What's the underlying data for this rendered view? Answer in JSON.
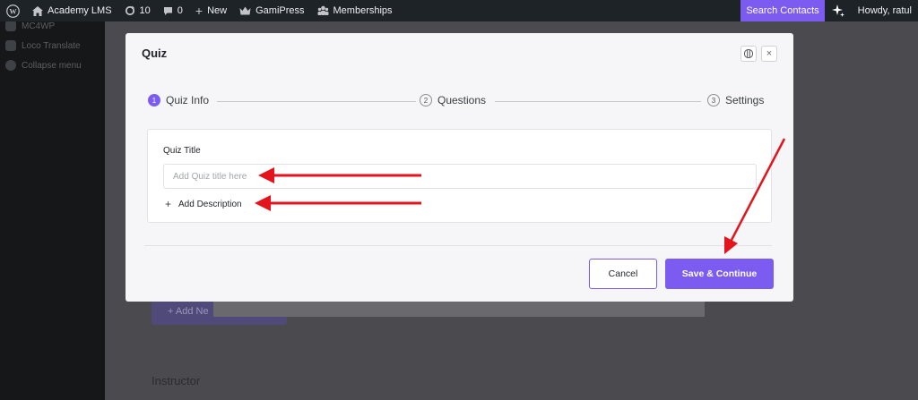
{
  "adminbar": {
    "wp_logo_icon": "wordpress-icon",
    "site_name": "Academy LMS",
    "updates_count": "10",
    "comments_count": "0",
    "new_label": "New",
    "gamipress_label": "GamiPress",
    "memberships_label": "Memberships",
    "search_contacts_label": "Search Contacts",
    "greeting": "Howdy, ratul"
  },
  "sidebar": {
    "items": [
      {
        "label": "MC4WP",
        "icon": "mc4wp-icon"
      },
      {
        "label": "Loco Translate",
        "icon": "translate-icon"
      },
      {
        "label": "Collapse menu",
        "icon": "collapse-icon"
      }
    ]
  },
  "background_page": {
    "add_button_label": "+ Add Ne",
    "section_heading": "Instructor"
  },
  "modal": {
    "title": "Quiz",
    "steps": [
      {
        "number": "1",
        "label": "Quiz Info",
        "active": true
      },
      {
        "number": "2",
        "label": "Questions",
        "active": false
      },
      {
        "number": "3",
        "label": "Settings",
        "active": false
      }
    ],
    "quiz_title_label": "Quiz Title",
    "quiz_title_value": "",
    "quiz_title_placeholder": "Add Quiz title here",
    "add_description_label": "Add Description",
    "cancel_label": "Cancel",
    "save_label": "Save & Continue"
  },
  "colors": {
    "accent": "#7c5cf0",
    "adminbar_bg": "#1d2327",
    "annotation_arrow": "#e3141c"
  }
}
